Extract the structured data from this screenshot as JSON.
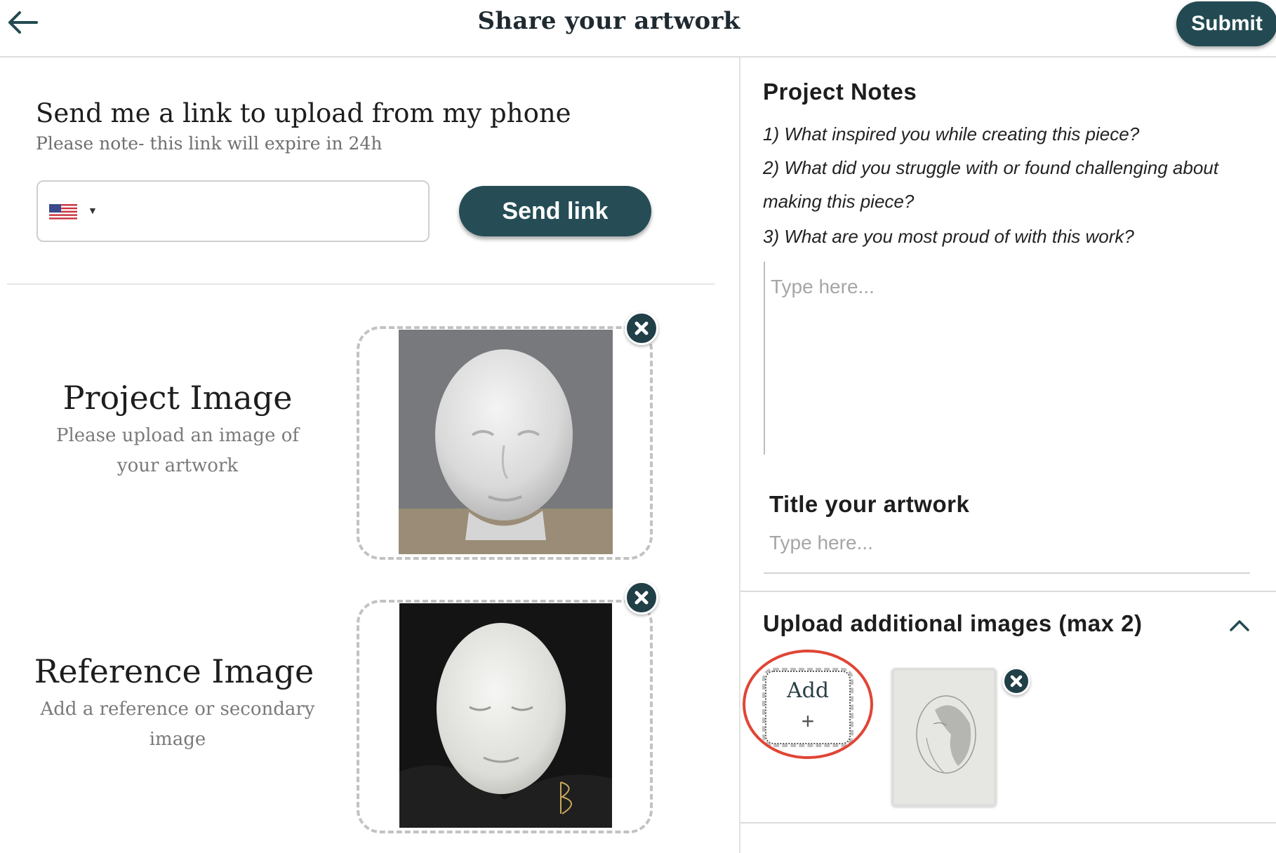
{
  "header": {
    "title": "Share your artwork",
    "submit_label": "Submit"
  },
  "phone_upload": {
    "heading": "Send me a link to upload from my phone",
    "note": "Please note- this link will expire in 24h",
    "send_label": "Send link"
  },
  "project_image": {
    "title": "Project Image",
    "subtitle": "Please upload an image of your artwork"
  },
  "reference_image": {
    "title": "Reference Image",
    "subtitle": "Add a reference or secondary image"
  },
  "project_notes": {
    "heading": "Project Notes",
    "q1": "1) What inspired you while creating this piece?",
    "q2a": "2) What did you struggle with or found challenging about",
    "q2b": "making this piece?",
    "q3": "3) What are you most proud of with this work?",
    "placeholder": "Type here..."
  },
  "title_section": {
    "heading": "Title your artwork",
    "placeholder": "Type here..."
  },
  "additional_images": {
    "heading": "Upload additional images (max 2)",
    "add_label": "Add",
    "add_plus": "+"
  },
  "colors": {
    "accent": "#234a52",
    "highlight": "#e04535"
  },
  "icons": [
    "back-arrow-icon",
    "remove-icon",
    "chevron-up-icon",
    "us-flag-icon",
    "caret-down-icon"
  ]
}
